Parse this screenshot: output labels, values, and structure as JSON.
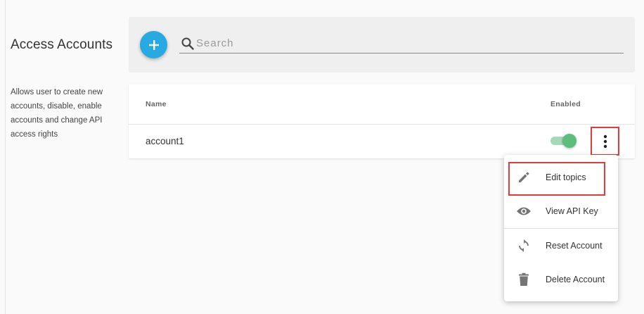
{
  "page": {
    "title": "Access Accounts",
    "description": "Allows user to create new accounts, disable, enable accounts and change API access rights"
  },
  "toolbar": {
    "add_icon": "plus-icon",
    "search_icon": "search-icon",
    "search_placeholder": "Search",
    "search_value": ""
  },
  "table": {
    "columns": [
      "Name",
      "Enabled"
    ],
    "rows": [
      {
        "name": "account1",
        "enabled": true
      }
    ]
  },
  "row_menu": {
    "items": [
      {
        "label": "Edit topics",
        "icon": "pencil-icon"
      },
      {
        "label": "View API Key",
        "icon": "eye-icon"
      },
      {
        "label": "Reset Account",
        "icon": "refresh-icon"
      },
      {
        "label": "Delete Account",
        "icon": "trash-icon"
      }
    ]
  },
  "colors": {
    "accent": "#27aae1",
    "toggle_on": "#5cbe7b",
    "highlight": "#e03c3c"
  }
}
